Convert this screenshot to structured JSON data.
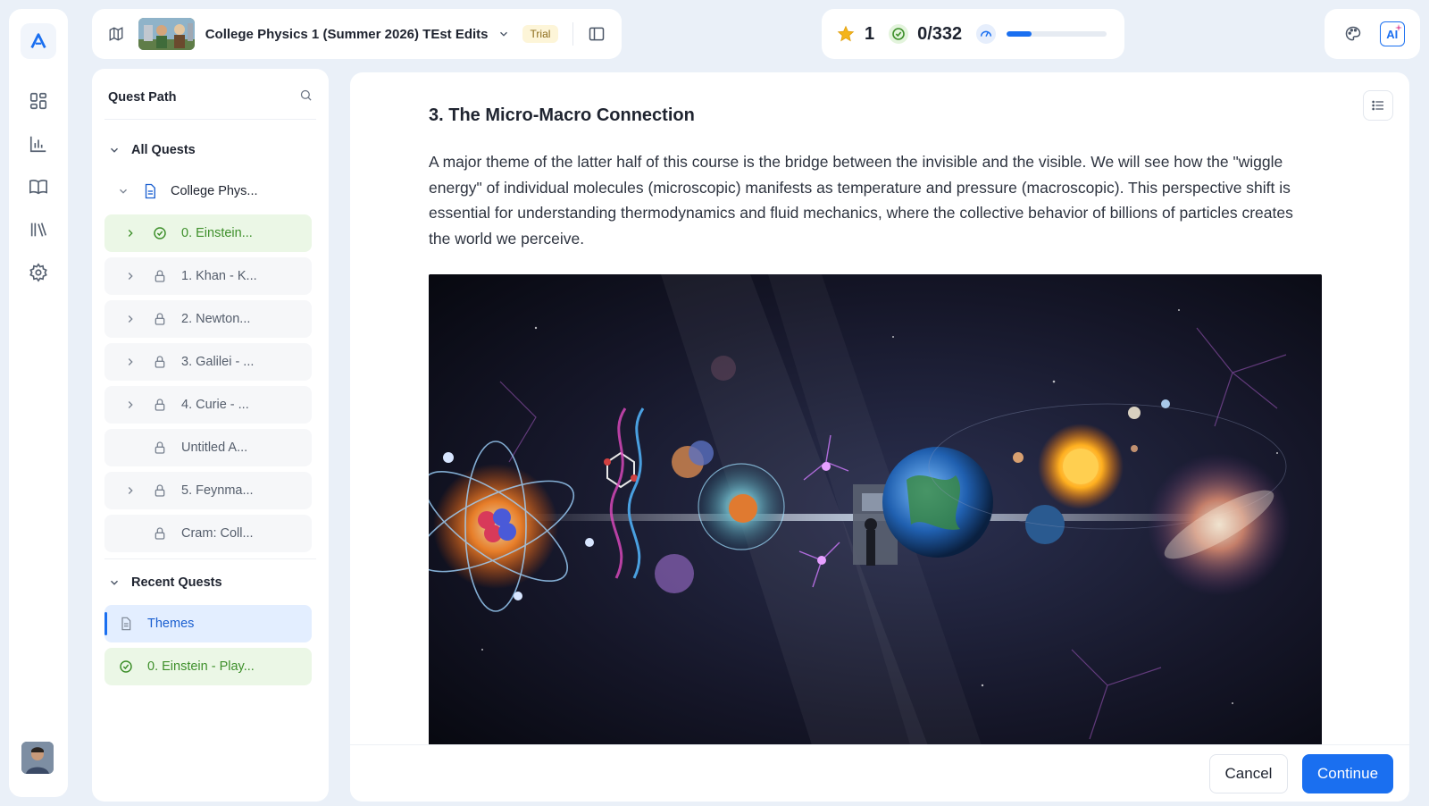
{
  "course": {
    "title": "College Physics 1 (Summer 2026) TEst Edits",
    "badge": "Trial"
  },
  "stats": {
    "stars": "1",
    "completed": "0/332",
    "progress_fraction": 0.25
  },
  "tools": {
    "ai_label": "AI"
  },
  "sidebar": {
    "title": "Quest Path",
    "all_quests_label": "All Quests",
    "course_item": "College Phys...",
    "quests": [
      {
        "label": "0. Einstein...",
        "status": "done",
        "expandable": true
      },
      {
        "label": "1. Khan - K...",
        "status": "locked",
        "expandable": true
      },
      {
        "label": "2. Newton...",
        "status": "locked",
        "expandable": true
      },
      {
        "label": "3. Galilei - ...",
        "status": "locked",
        "expandable": true
      },
      {
        "label": "4. Curie - ...",
        "status": "locked",
        "expandable": true
      },
      {
        "label": "Untitled A...",
        "status": "locked",
        "expandable": false
      },
      {
        "label": "5. Feynma...",
        "status": "locked",
        "expandable": true
      },
      {
        "label": "Cram: Coll...",
        "status": "locked",
        "expandable": false
      }
    ],
    "recent_label": "Recent Quests",
    "recent": [
      {
        "label": "Themes",
        "status": "active"
      },
      {
        "label": "0. Einstein - Play...",
        "status": "done"
      }
    ]
  },
  "content": {
    "heading": "3. The Micro-Macro Connection",
    "paragraph": "A major theme of the latter half of this course is the bridge between the invisible and the visible. We will see how the \"wiggle energy\" of individual molecules (microscopic) manifests as temperature and pressure (macroscopic). This perspective shift is essential for understanding thermodynamics and fluid mechanics, where the collective behavior of billions of particles creates the world we perceive."
  },
  "actions": {
    "cancel": "Cancel",
    "continue": "Continue"
  },
  "colors": {
    "accent": "#1a6ff0",
    "done": "#3d8f2a",
    "background": "#eaf0f8"
  },
  "icons": {
    "rail": [
      "dashboard-icon",
      "analytics-icon",
      "book-icon",
      "library-icon",
      "settings-icon"
    ]
  }
}
